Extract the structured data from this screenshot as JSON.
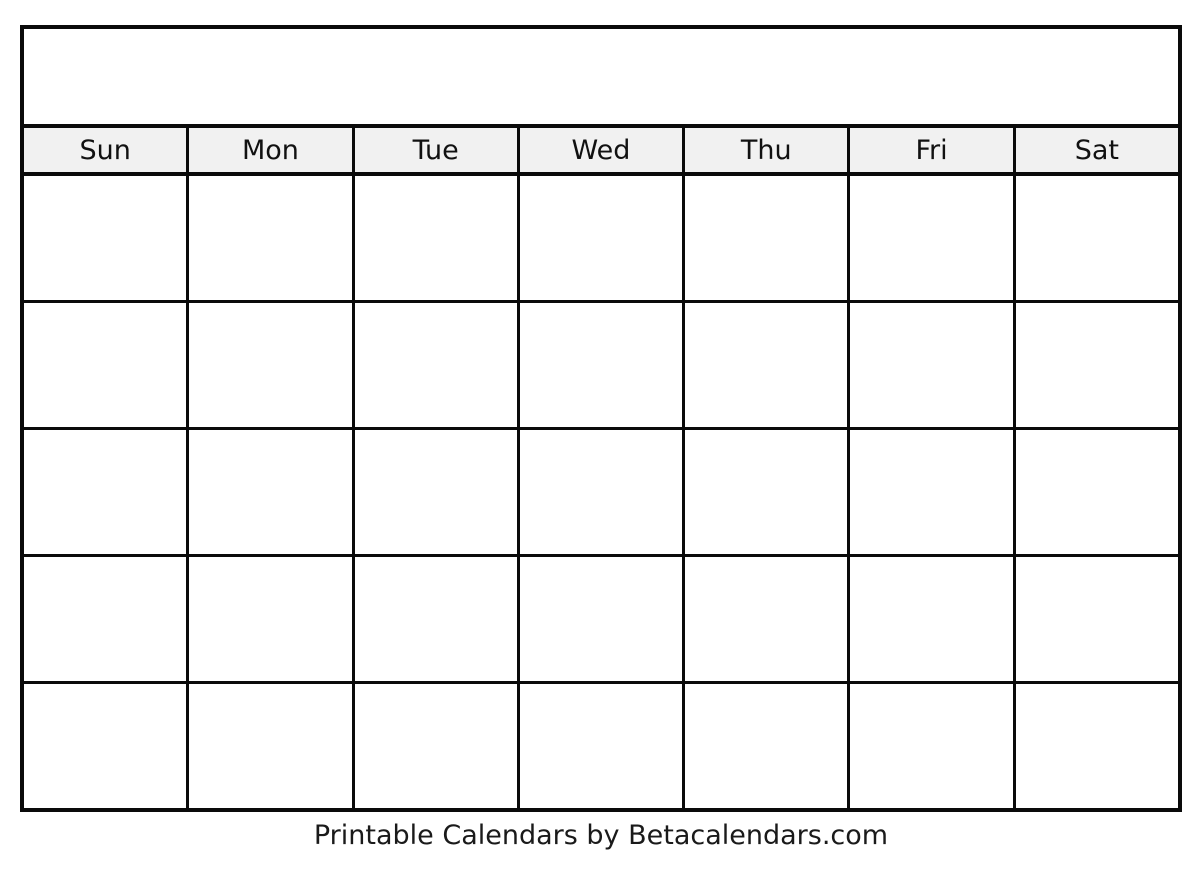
{
  "document": {
    "type": "blank-monthly-calendar",
    "title": "",
    "week_start": "Sun"
  },
  "header": {
    "weekdays": [
      {
        "label": "Sun"
      },
      {
        "label": "Mon"
      },
      {
        "label": "Tue"
      },
      {
        "label": "Wed"
      },
      {
        "label": "Thu"
      },
      {
        "label": "Fri"
      },
      {
        "label": "Sat"
      }
    ]
  },
  "grid": {
    "columns": 7,
    "rows": 5,
    "weeks": [
      {
        "days": [
          {
            "number": ""
          },
          {
            "number": ""
          },
          {
            "number": ""
          },
          {
            "number": ""
          },
          {
            "number": ""
          },
          {
            "number": ""
          },
          {
            "number": ""
          }
        ]
      },
      {
        "days": [
          {
            "number": ""
          },
          {
            "number": ""
          },
          {
            "number": ""
          },
          {
            "number": ""
          },
          {
            "number": ""
          },
          {
            "number": ""
          },
          {
            "number": ""
          }
        ]
      },
      {
        "days": [
          {
            "number": ""
          },
          {
            "number": ""
          },
          {
            "number": ""
          },
          {
            "number": ""
          },
          {
            "number": ""
          },
          {
            "number": ""
          },
          {
            "number": ""
          }
        ]
      },
      {
        "days": [
          {
            "number": ""
          },
          {
            "number": ""
          },
          {
            "number": ""
          },
          {
            "number": ""
          },
          {
            "number": ""
          },
          {
            "number": ""
          },
          {
            "number": ""
          }
        ]
      },
      {
        "days": [
          {
            "number": ""
          },
          {
            "number": ""
          },
          {
            "number": ""
          },
          {
            "number": ""
          },
          {
            "number": ""
          },
          {
            "number": ""
          },
          {
            "number": ""
          }
        ]
      }
    ]
  },
  "footer": {
    "credit": "Printable Calendars by Betacalendars.com"
  },
  "colors": {
    "border": "#0a0a0a",
    "header_background": "#f1f1f1",
    "cell_background": "#ffffff",
    "page_background": "#ffffff",
    "text": "#111111"
  }
}
